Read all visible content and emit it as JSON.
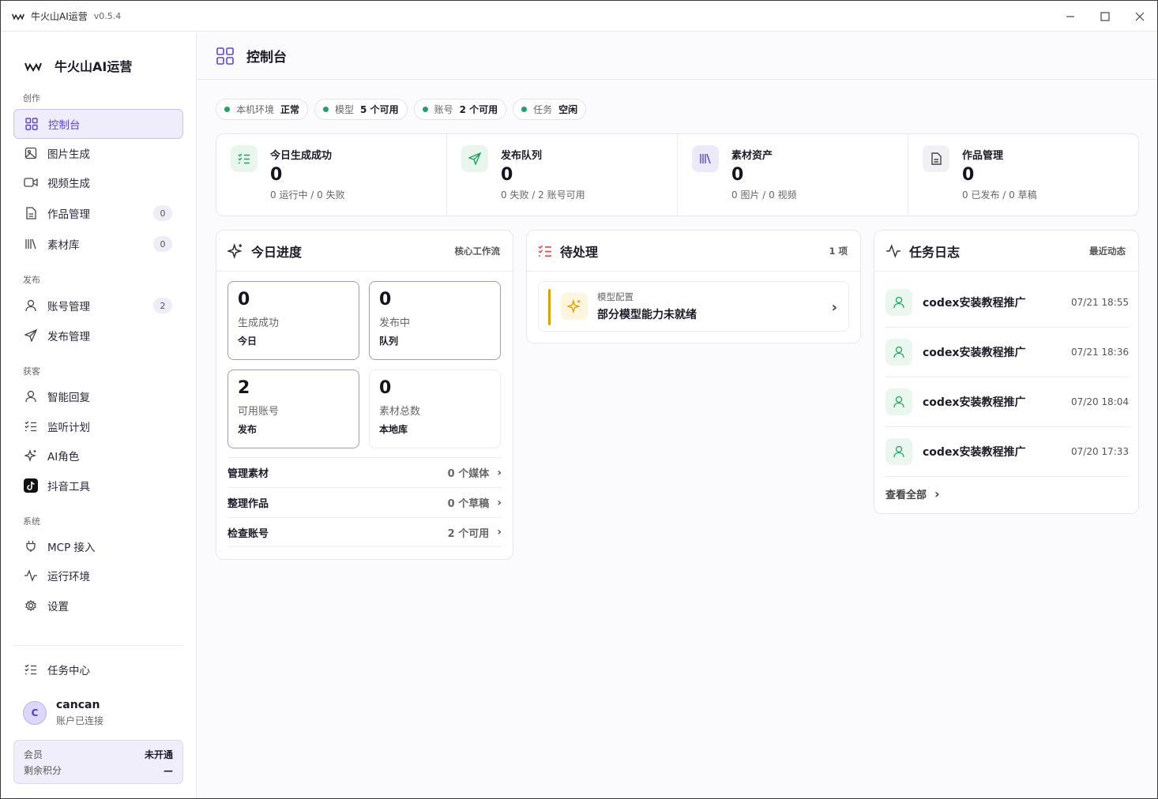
{
  "window": {
    "title": "牛火山AI运营",
    "version": "v0.5.4"
  },
  "sidebar": {
    "brand": "牛火山AI运营",
    "groups": {
      "create": "创作",
      "publish": "发布",
      "acquire": "获客",
      "system": "系统"
    },
    "items": [
      {
        "label": "控制台",
        "icon": "dashboard-icon"
      },
      {
        "label": "图片生成",
        "icon": "image-icon"
      },
      {
        "label": "视频生成",
        "icon": "video-icon"
      },
      {
        "label": "作品管理",
        "icon": "document-icon",
        "badge": "0"
      },
      {
        "label": "素材库",
        "icon": "library-icon",
        "badge": "0"
      },
      {
        "label": "账号管理",
        "icon": "user-icon",
        "badge": "2"
      },
      {
        "label": "发布管理",
        "icon": "send-icon"
      },
      {
        "label": "智能回复",
        "icon": "user-icon"
      },
      {
        "label": "监听计划",
        "icon": "list-check-icon"
      },
      {
        "label": "AI角色",
        "icon": "sparkles-icon"
      },
      {
        "label": "抖音工具",
        "icon": "tiktok-icon"
      },
      {
        "label": "MCP 接入",
        "icon": "plug-icon"
      },
      {
        "label": "运行环境",
        "icon": "activity-icon"
      },
      {
        "label": "设置",
        "icon": "gear-icon"
      }
    ],
    "task_center": "任务中心",
    "user": {
      "initial": "C",
      "name": "cancan",
      "status": "账户已连接"
    },
    "member": {
      "label": "会员",
      "value": "未开通",
      "points_label": "剩余积分",
      "points_value": "—"
    }
  },
  "header": {
    "title": "控制台"
  },
  "status_chips": [
    {
      "label": "本机环境",
      "value": "正常"
    },
    {
      "label": "模型",
      "value": "5 个可用"
    },
    {
      "label": "账号",
      "value": "2 个可用"
    },
    {
      "label": "任务",
      "value": "空闲"
    }
  ],
  "stats": [
    {
      "label": "今日生成成功",
      "value": "0",
      "sub": "0 运行中 / 0 失败",
      "icon": "list-check-icon"
    },
    {
      "label": "发布队列",
      "value": "0",
      "sub": "0 失败 / 2 账号可用",
      "icon": "send-icon"
    },
    {
      "label": "素材资产",
      "value": "0",
      "sub": "0 图片 / 0 视频",
      "icon": "library-icon"
    },
    {
      "label": "作品管理",
      "value": "0",
      "sub": "0 已发布 / 0 草稿",
      "icon": "document-icon"
    }
  ],
  "progress": {
    "title": "今日进度",
    "right": "核心工作流",
    "tiles": [
      {
        "value": "0",
        "label": "生成成功",
        "sub": "今日"
      },
      {
        "value": "0",
        "label": "发布中",
        "sub": "队列"
      },
      {
        "value": "2",
        "label": "可用账号",
        "sub": "发布"
      },
      {
        "value": "0",
        "label": "素材总数",
        "sub": "本地库"
      }
    ],
    "links": [
      {
        "label": "管理素材",
        "value": "0 个媒体"
      },
      {
        "label": "整理作品",
        "value": "0 个草稿"
      },
      {
        "label": "检查账号",
        "value": "2 个可用"
      }
    ]
  },
  "pending": {
    "title": "待处理",
    "right": "1 项",
    "item": {
      "category": "模型配置",
      "text": "部分模型能力未就绪"
    }
  },
  "logs": {
    "title": "任务日志",
    "right": "最近动态",
    "items": [
      {
        "title": "codex安装教程推广",
        "time": "07/21 18:55"
      },
      {
        "title": "codex安装教程推广",
        "time": "07/21 18:36"
      },
      {
        "title": "codex安装教程推广",
        "time": "07/20 18:04"
      },
      {
        "title": "codex安装教程推广",
        "time": "07/20 17:33"
      }
    ],
    "view_all": "查看全部"
  },
  "colors": {
    "accent": "#5b46d6",
    "success": "#1ea362",
    "warning": "#e0a400",
    "danger": "#e04848"
  }
}
